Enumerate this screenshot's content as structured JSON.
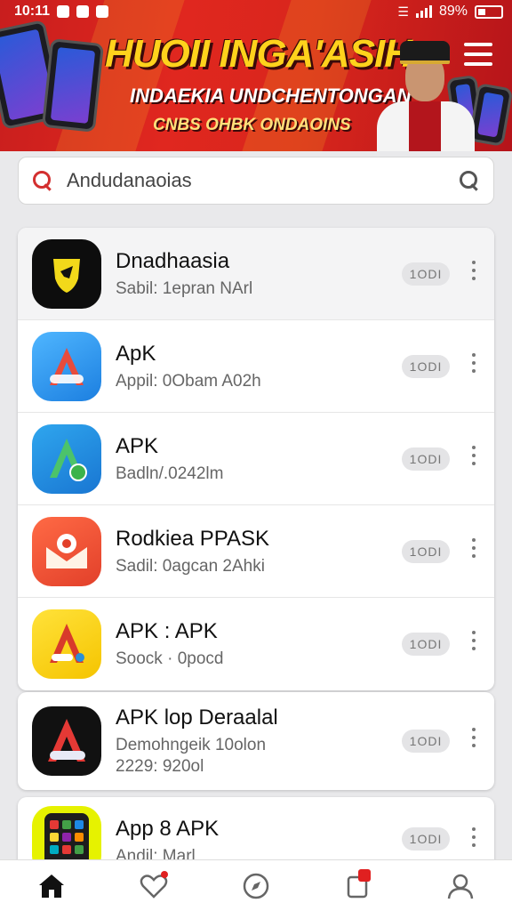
{
  "status_bar": {
    "time": "10:11",
    "battery": "89%"
  },
  "banner": {
    "headline": "HUOII INGA'ASIH",
    "subline": "INDAEKIA UNDCHENTONGAN",
    "tagline": "CNBS OHBK ONDAOINS"
  },
  "search": {
    "value": "Andudanaoias"
  },
  "colors": {
    "accent": "#d32f2f",
    "banner_red": "#e0271f",
    "headline_yellow": "#ffd21c"
  },
  "apps": [
    {
      "name": "Dnadhaasia",
      "sub": "Sabil: 1epran NArl",
      "badge": "1ODI",
      "icon": "shield-logo-icon"
    },
    {
      "name": "ApK",
      "sub": "Appil: 0Obam A02h",
      "badge": "1ODI",
      "icon": "apk-blue-icon"
    },
    {
      "name": "APK",
      "sub": "Badln/.0242lm",
      "badge": "1ODI",
      "icon": "apk-green-icon"
    },
    {
      "name": "Rodkiea PPASK",
      "sub": "Sadil: 0agcan 2Ahki",
      "badge": "1ODI",
      "icon": "envelope-icon"
    },
    {
      "name": "APK : APK",
      "sub": "Soock · 0pocd",
      "badge": "1ODI",
      "icon": "apk-yellow-icon"
    },
    {
      "name": "APK lop Deraalal",
      "sub": "Demohngeik 10olon",
      "sub2": "2229: 920ol",
      "badge": "1ODI",
      "icon": "apk-dark-icon"
    },
    {
      "name": "App 8 APK",
      "sub": "Andil: Marl",
      "badge": "1ODI",
      "icon": "app-grid-icon"
    }
  ],
  "nav": [
    "home",
    "favorites",
    "explore",
    "notifications",
    "profile"
  ]
}
